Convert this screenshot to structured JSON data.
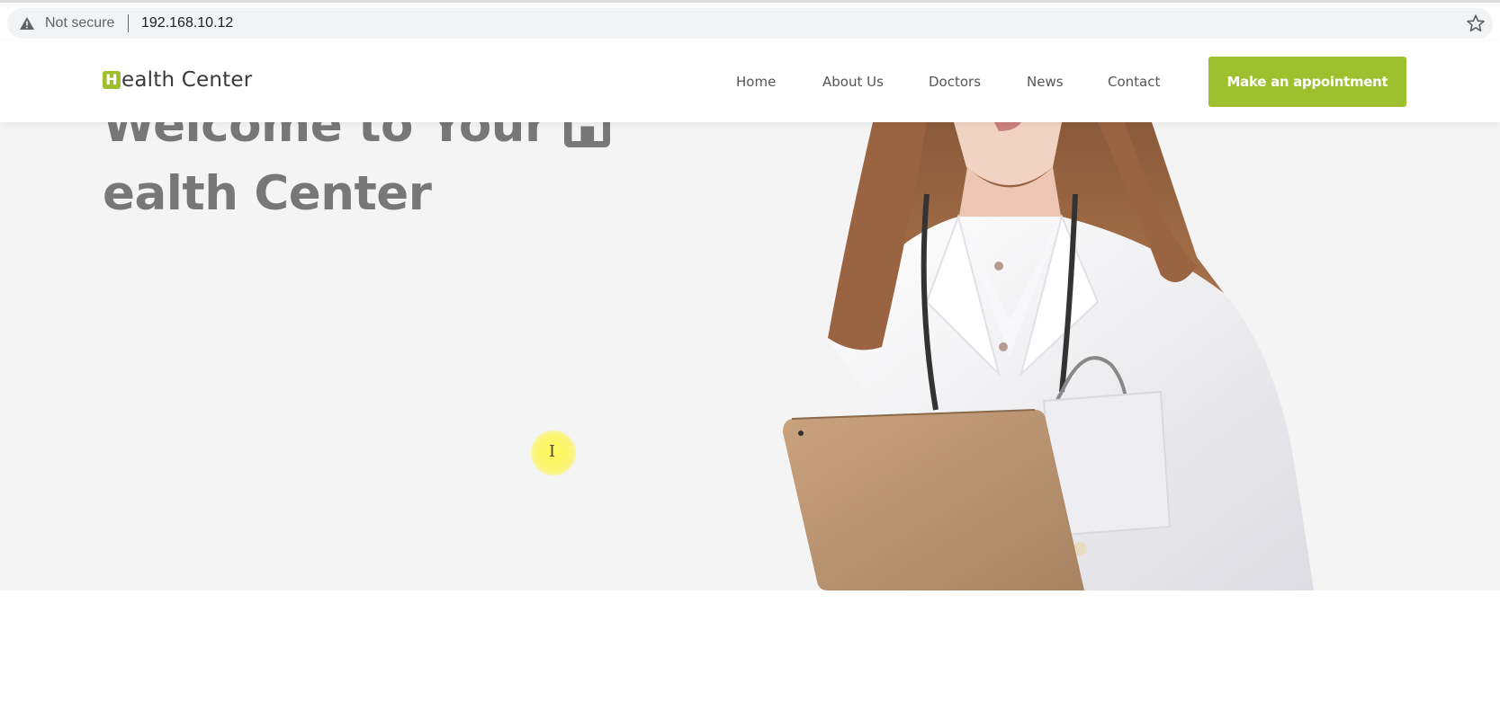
{
  "browser": {
    "security_label": "Not secure",
    "url": "192.168.10.12",
    "warning_icon": "warning-triangle-icon",
    "bookmark_icon": "star-icon"
  },
  "header": {
    "logo_initial": "H",
    "logo_rest": "ealth Center",
    "nav": [
      "Home",
      "About Us",
      "Doctors",
      "News",
      "Contact"
    ],
    "cta_label": "Make an appointment"
  },
  "hero": {
    "title_part1": "Welcome to Your ",
    "title_initial": "H",
    "title_part2": "ealth Center"
  },
  "colors": {
    "accent": "#9dc12e",
    "hero_bg": "#f4f4f4",
    "hero_text": "#777777"
  }
}
